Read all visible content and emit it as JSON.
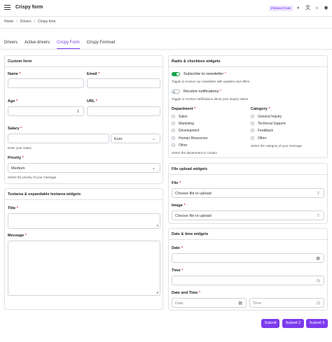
{
  "header": {
    "title": "Crispy form",
    "env_badge": "PRODUCTION"
  },
  "breadcrumb": [
    "Home",
    "Drivers",
    "Crispy form"
  ],
  "tabs": [
    "Drivers",
    "Active drivers",
    "Crispy Form",
    "Crispy Formset"
  ],
  "custom_form": {
    "title": "Custom form",
    "name_label": "Name",
    "email_label": "Email",
    "age_label": "Age",
    "url_label": "URL",
    "salary_label": "Salary",
    "salary_help": "Enter your salary",
    "currency_value": "Euro",
    "priority_label": "Priority",
    "priority_value": "Medium",
    "priority_help": "Select the priority of your message"
  },
  "textarea_card": {
    "title": "Textarea & expandable textarea widgets",
    "title_label": "Title",
    "message_label": "Message"
  },
  "radio_card": {
    "title": "Radio & checkbox widgets",
    "subscribe_label": "Subscribe to newsletter",
    "subscribe_help": "Toggle to receive our newsletter with updates and offers",
    "subscribe_on": true,
    "notif_label": "Receive notifications",
    "notif_help": "Toggle to receive notifications about your inquiry status",
    "notif_on": false,
    "department_label": "Department",
    "departments": [
      "Sales",
      "Marketing",
      "Development",
      "Human Resources",
      "Other"
    ],
    "department_help": "Select the department to contact",
    "category_label": "Category",
    "categories": [
      "General Inquiry",
      "Technical Support",
      "Feedback",
      "Other"
    ],
    "category_help": "Select the category of your message"
  },
  "file_card": {
    "title": "File upload widgets",
    "file_label": "File",
    "file_placeholder": "Choose file to upload",
    "image_label": "Image",
    "image_placeholder": "Choose file to upload"
  },
  "date_card": {
    "title": "Date & time widgets",
    "date_label": "Date",
    "time_label": "Time",
    "datetime_label": "Date and Time",
    "date_placeholder": "Date",
    "time_placeholder": "Time"
  },
  "buttons": [
    "Submit",
    "Submit 2",
    "Submit 3"
  ],
  "colors": {
    "accent": "#7c3aed",
    "toggle_on": "#16a34a",
    "required": "#dc3545"
  }
}
